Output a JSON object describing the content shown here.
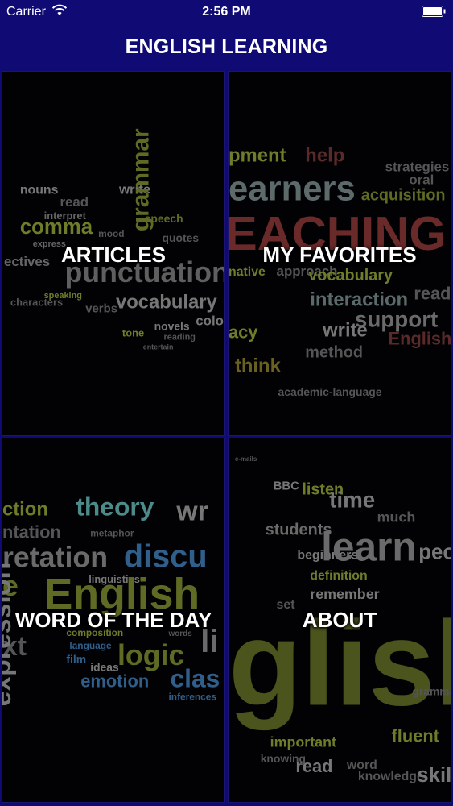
{
  "status_bar": {
    "carrier": "Carrier",
    "time": "2:56 PM"
  },
  "nav": {
    "title": "ENGLISH LEARNING"
  },
  "tiles": [
    {
      "label": "ARTICLES",
      "icon": "word-cloud-writing"
    },
    {
      "label": "MY FAVORITES",
      "icon": "word-cloud-teaching"
    },
    {
      "label": "WORD OF THE DAY",
      "icon": "word-cloud-english"
    },
    {
      "label": "ABOUT",
      "icon": "word-cloud-learn"
    }
  ],
  "colors": {
    "nav_bg": "#0f0a74",
    "tile_bg": "#020204"
  }
}
